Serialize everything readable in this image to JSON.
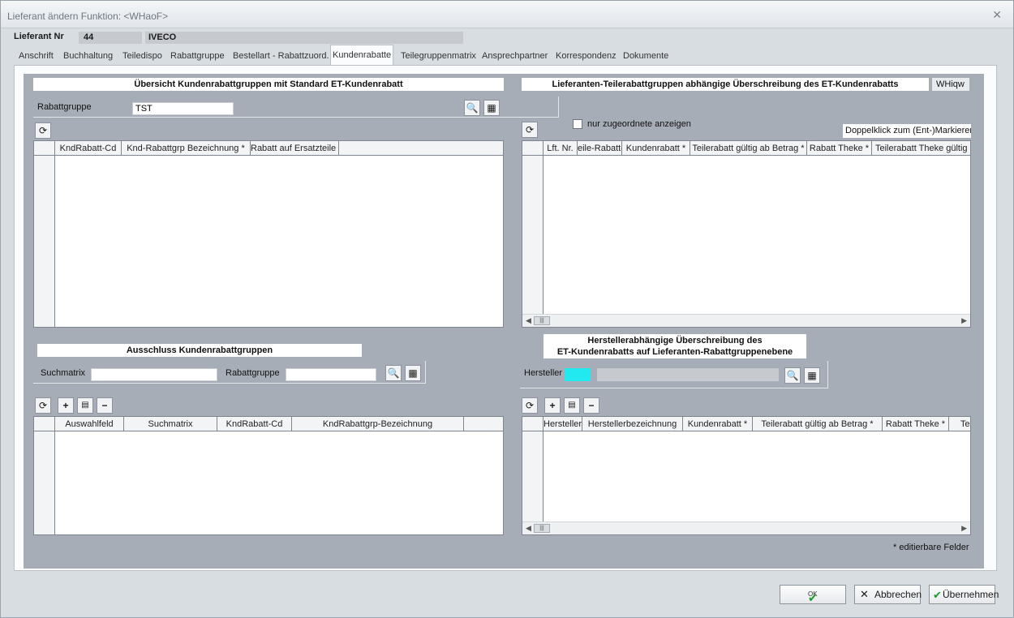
{
  "window": {
    "title": "Lieferant ändern   Funktion: <WHaoF>"
  },
  "supplier": {
    "label": "Lieferant Nr",
    "number": "44",
    "name": "IVECO"
  },
  "tabs": [
    "Anschrift",
    "Buchhaltung",
    "Teiledispo",
    "Rabattgruppe",
    "Bestellart - Rabattzuord.",
    "Kundenrabatte",
    "Teilegruppenmatrix",
    "Ansprechpartner",
    "Korrespondenz",
    "Dokumente"
  ],
  "active_tab": "Kundenrabatte",
  "left_top": {
    "title": "Übersicht Kundenrabattgruppen mit Standard ET-Kundenrabatt",
    "filter_label": "Rabattgruppe",
    "filter_value": "TST",
    "columns": [
      "KndRabatt-Cd",
      "Knd-Rabattgrp Bezeichnung *",
      "Rabatt auf Ersatzteile *"
    ]
  },
  "right_top": {
    "title": "Lieferanten-Teilerabattgruppen abhängige Überschreibung des ET-Kundenrabatts",
    "tag": "WHiqw",
    "checkbox_label": "nur zugeordnete anzeigen",
    "hint": "Doppelklick zum (Ent-)Markieren",
    "columns": [
      "Lft. Nr.",
      "eile-Rabattg",
      "Kundenrabatt *",
      "Teilerabatt gültig ab Betrag *",
      "Rabatt Theke *",
      "Teilerabatt Theke gültig a"
    ]
  },
  "left_bottom": {
    "title": "Ausschluss Kundenrabattgruppen",
    "suchmatrix_label": "Suchmatrix",
    "rabattgruppe_label": "Rabattgruppe",
    "columns": [
      "Auswahlfeld",
      "Suchmatrix",
      "KndRabatt-Cd",
      "KndRabattgrp-Bezeichnung"
    ]
  },
  "right_bottom": {
    "title_line1": "Herstellerabhängige Überschreibung des",
    "title_line2": "ET-Kundenrabatts auf Lieferanten-Rabattgruppenebene",
    "hersteller_label": "Hersteller",
    "columns": [
      "Hersteller",
      "Herstellerbezeichnung",
      "Kundenrabatt *",
      "Teilerabatt gültig ab Betrag *",
      "Rabatt Theke *",
      "Te"
    ]
  },
  "footnote": "* editierbare Felder",
  "buttons": {
    "ok": "OK",
    "cancel": "Abbrechen",
    "apply": "Übernehmen"
  },
  "colors": {
    "hersteller_field": "#22e8f0",
    "content_bg": "#a6adb6"
  }
}
